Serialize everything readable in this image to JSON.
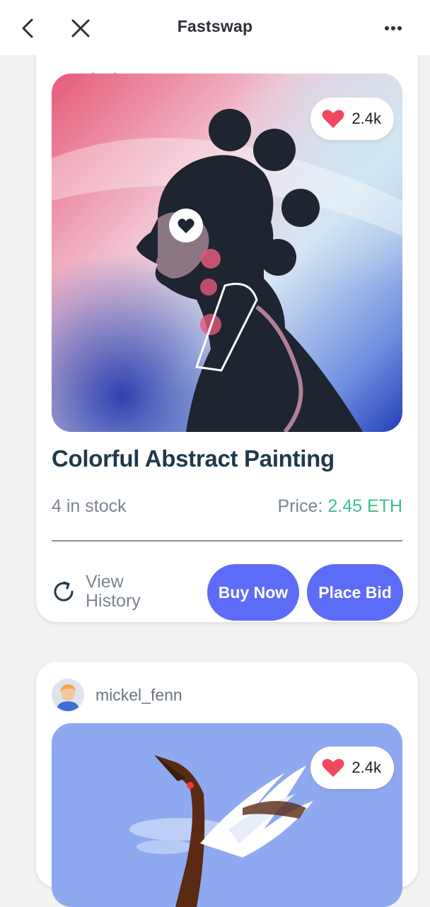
{
  "header": {
    "title": "Fastswap",
    "back_icon": "chevron-left-icon",
    "close_icon": "close-icon",
    "more_icon": "more-horizontal-icon"
  },
  "cards": [
    {
      "title": "Colorful Abstract Painting",
      "likes": "2.4k",
      "stock": "4 in stock",
      "price_label": "Price:",
      "price_value": "2.45 ETH",
      "history_label": "View History",
      "buy_label": "Buy Now",
      "bid_label": "Place Bid"
    },
    {
      "owner": "mickel_fenn",
      "likes": "2.4k"
    }
  ],
  "colors": {
    "accent": "#5d6cf6",
    "price": "#3cc08a",
    "heart": "#f0495f",
    "title": "#1f3a4a"
  }
}
